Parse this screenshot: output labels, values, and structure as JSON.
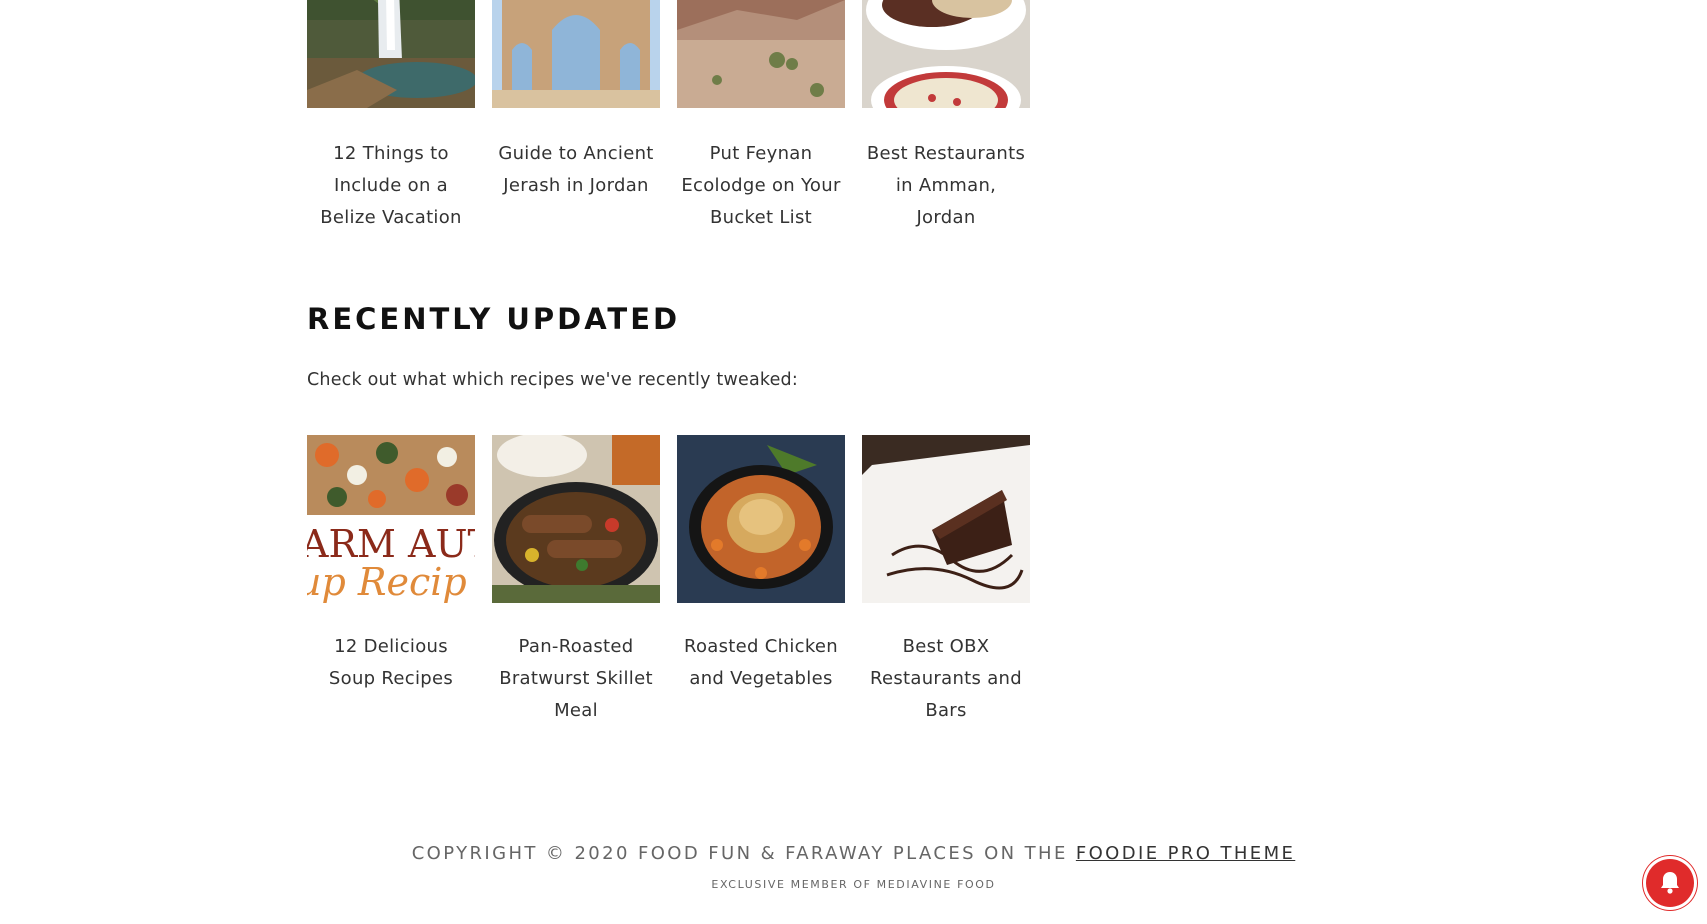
{
  "related_posts": [
    {
      "title": "12 Things to Include on a Belize Vacation",
      "image": "waterfall-photo"
    },
    {
      "title": "Guide to Ancient Jerash in Jordan",
      "image": "stone-arch-photo"
    },
    {
      "title": "Put Feynan Ecolodge on Your Bucket List",
      "image": "desert-valley-photo"
    },
    {
      "title": "Best Restaurants in Amman, Jordan",
      "image": "plated-meal-photo"
    }
  ],
  "recently_updated": {
    "heading": "RECENTLY UPDATED",
    "intro": "Check out what which recipes we've recently tweaked:",
    "posts": [
      {
        "title": "12 Delicious Soup Recipes",
        "image": "soup-collage-photo",
        "overlay_line1": "ARM AUTU",
        "overlay_line2": "up Recip"
      },
      {
        "title": "Pan-Roasted Bratwurst Skillet Meal",
        "image": "bratwurst-skillet-photo"
      },
      {
        "title": "Roasted Chicken and Vegetables",
        "image": "roast-chicken-photo"
      },
      {
        "title": "Best OBX Restaurants and Bars",
        "image": "chocolate-cake-photo"
      }
    ]
  },
  "footer": {
    "copyright_prefix": "COPYRIGHT © 2020 FOOD FUN & FARAWAY PLACES ON THE ",
    "theme_link": "FOODIE PRO THEME",
    "member_line": "EXCLUSIVE MEMBER OF MEDIAVINE FOOD"
  },
  "notification_button": {
    "icon": "bell-icon",
    "color": "#e02b2b"
  }
}
